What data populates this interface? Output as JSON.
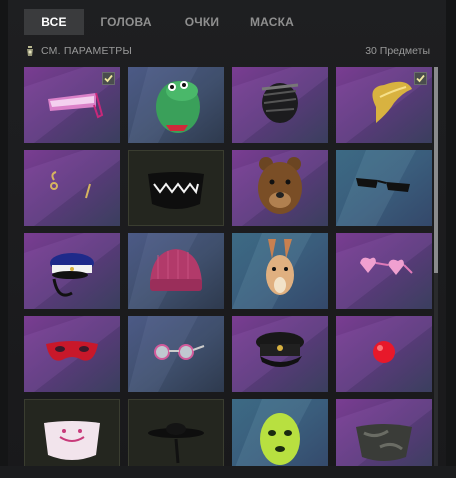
{
  "tabs": [
    {
      "label": "ВСЕ",
      "active": true
    },
    {
      "label": "ГОЛОВА",
      "active": false
    },
    {
      "label": "ОЧКИ",
      "active": false
    },
    {
      "label": "МАСКА",
      "active": false
    }
  ],
  "filter": {
    "label": "СМ. ПАРАМЕТРЫ",
    "icon": "filter-icon"
  },
  "item_count": "30 Предметы",
  "colors": {
    "active_tab": "#3a3b3d",
    "purple_rarity": "#6b3a8a",
    "blue_rarity": "#3d5a7a",
    "dark_rarity": "#232520",
    "checkmark": "#f2e8a0"
  },
  "items": [
    {
      "name": "cyber-visor-glasses-icon",
      "bg": "purple",
      "equipped": true
    },
    {
      "name": "dinosaur-head-mask-icon",
      "bg": "blue",
      "equipped": false
    },
    {
      "name": "muzzle-mask-icon",
      "bg": "purple",
      "equipped": false
    },
    {
      "name": "golden-wings-mask-icon",
      "bg": "purple",
      "equipped": true
    },
    {
      "name": "earrings-icon",
      "bg": "purple",
      "equipped": false
    },
    {
      "name": "shark-teeth-face-mask-icon",
      "bg": "dark",
      "equipped": false
    },
    {
      "name": "bear-head-mask-icon",
      "bg": "purple",
      "equipped": false
    },
    {
      "name": "black-sunglasses-icon",
      "bg": "teal",
      "equipped": false
    },
    {
      "name": "police-cap-icon",
      "bg": "purple",
      "equipped": false
    },
    {
      "name": "beanie-hat-icon",
      "bg": "blue",
      "equipped": false
    },
    {
      "name": "bunny-mask-icon",
      "bg": "teal",
      "equipped": false
    },
    {
      "name": "heart-glasses-icon",
      "bg": "purple",
      "equipped": false
    },
    {
      "name": "red-eye-mask-icon",
      "bg": "purple",
      "equipped": false
    },
    {
      "name": "round-sunglasses-icon",
      "bg": "blue",
      "equipped": false
    },
    {
      "name": "officer-cap-icon",
      "bg": "purple",
      "equipped": false
    },
    {
      "name": "clown-nose-icon",
      "bg": "purple",
      "equipped": false
    },
    {
      "name": "cat-face-mask-icon",
      "bg": "dark",
      "equipped": false
    },
    {
      "name": "wide-brim-hat-icon",
      "bg": "dark",
      "equipped": false
    },
    {
      "name": "green-balaclava-icon",
      "bg": "teal",
      "equipped": false
    },
    {
      "name": "camo-face-mask-icon",
      "bg": "purple",
      "equipped": false
    }
  ]
}
